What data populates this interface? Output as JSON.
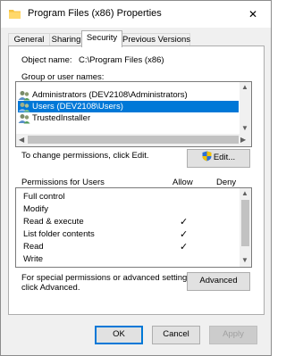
{
  "window": {
    "title": "Program Files (x86) Properties",
    "close_glyph": "✕"
  },
  "tabs": [
    {
      "label": "General",
      "active": false
    },
    {
      "label": "Sharing",
      "active": false
    },
    {
      "label": "Security",
      "active": true
    },
    {
      "label": "Previous Versions",
      "active": false
    }
  ],
  "object": {
    "label": "Object name:",
    "value": "C:\\Program Files (x86)"
  },
  "groups": {
    "label": "Group or user names:",
    "items": [
      {
        "name": "Administrators (DEV2108\\Administrators)",
        "selected": false
      },
      {
        "name": "Users (DEV2108\\Users)",
        "selected": true
      },
      {
        "name": "TrustedInstaller",
        "selected": false
      }
    ]
  },
  "change_text": "To change permissions, click Edit.",
  "edit_button": "Edit...",
  "permissions": {
    "header": "Permissions for Users",
    "allow_label": "Allow",
    "deny_label": "Deny",
    "rows": [
      {
        "name": "Full control",
        "allow": false,
        "deny": false
      },
      {
        "name": "Modify",
        "allow": false,
        "deny": false
      },
      {
        "name": "Read & execute",
        "allow": true,
        "deny": false
      },
      {
        "name": "List folder contents",
        "allow": true,
        "deny": false
      },
      {
        "name": "Read",
        "allow": true,
        "deny": false
      },
      {
        "name": "Write",
        "allow": false,
        "deny": false
      }
    ],
    "check_glyph": "✓"
  },
  "special": {
    "line1": "For special permissions or advanced settings,",
    "line2": "click Advanced.",
    "button": "Advanced"
  },
  "footer": {
    "ok": "OK",
    "cancel": "Cancel",
    "apply": "Apply"
  },
  "colors": {
    "selection": "#0078d7",
    "folder": "#f5c242",
    "shield_blue": "#2d6fd6",
    "shield_yellow": "#f2c200"
  },
  "icons": {
    "title": "folder-icon",
    "user": "users-icon",
    "edit": "uac-shield-icon",
    "scroll_left": "◀",
    "scroll_right": "▶",
    "scroll_up": "▲",
    "scroll_down": "▼"
  }
}
